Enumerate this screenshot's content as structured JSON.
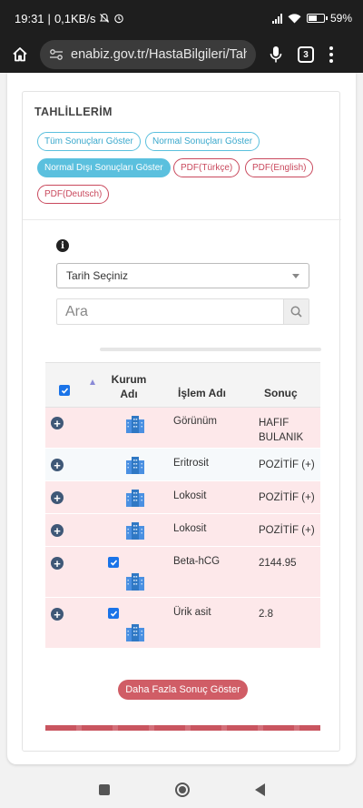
{
  "status_bar": {
    "time": "19:31",
    "network_speed": "0,1KB/s",
    "battery_percent": "59%"
  },
  "browser": {
    "url": "enabiz.gov.tr/HastaBilgileri/Tahliller",
    "tab_count": "3"
  },
  "section": {
    "title": "TAHLİLLERİM",
    "filters": {
      "all": "Tüm Sonuçları Göster",
      "normal": "Normal Sonuçları Göster",
      "abnormal": "Normal Dışı Sonuçları Göster",
      "pdf_tr": "PDF(Türkçe)",
      "pdf_en": "PDF(English)",
      "pdf_de": "PDF(Deutsch)"
    },
    "date_select": {
      "selected": "Tarih Seçiniz"
    },
    "search": {
      "placeholder": "Ara"
    },
    "table": {
      "headers": {
        "kurum": "Kurum Adı",
        "islem": "İşlem Adı",
        "sonuc": "Sonuç"
      },
      "rows": [
        {
          "islem": "Görünüm",
          "sonuc": "HAFIF BULANIK",
          "checked": false
        },
        {
          "islem": "Eritrosit",
          "sonuc": "POZİTİF (+)",
          "checked": false
        },
        {
          "islem": "Lokosit",
          "sonuc": "POZİTİF (+)",
          "checked": false
        },
        {
          "islem": "Lokosit",
          "sonuc": "POZİTİF (+)",
          "checked": false
        },
        {
          "islem": "Beta-hCG",
          "sonuc": "2144.95",
          "checked": true
        },
        {
          "islem": "Ürik asit",
          "sonuc": "2.8",
          "checked": true
        }
      ]
    },
    "more_button": "Daha Fazla Sonuç Göster"
  },
  "colors": {
    "pink_row": "#fde8ea",
    "accent_blue": "#5bc0de",
    "accent_red": "#c9495d",
    "button_red": "#d05d66"
  }
}
